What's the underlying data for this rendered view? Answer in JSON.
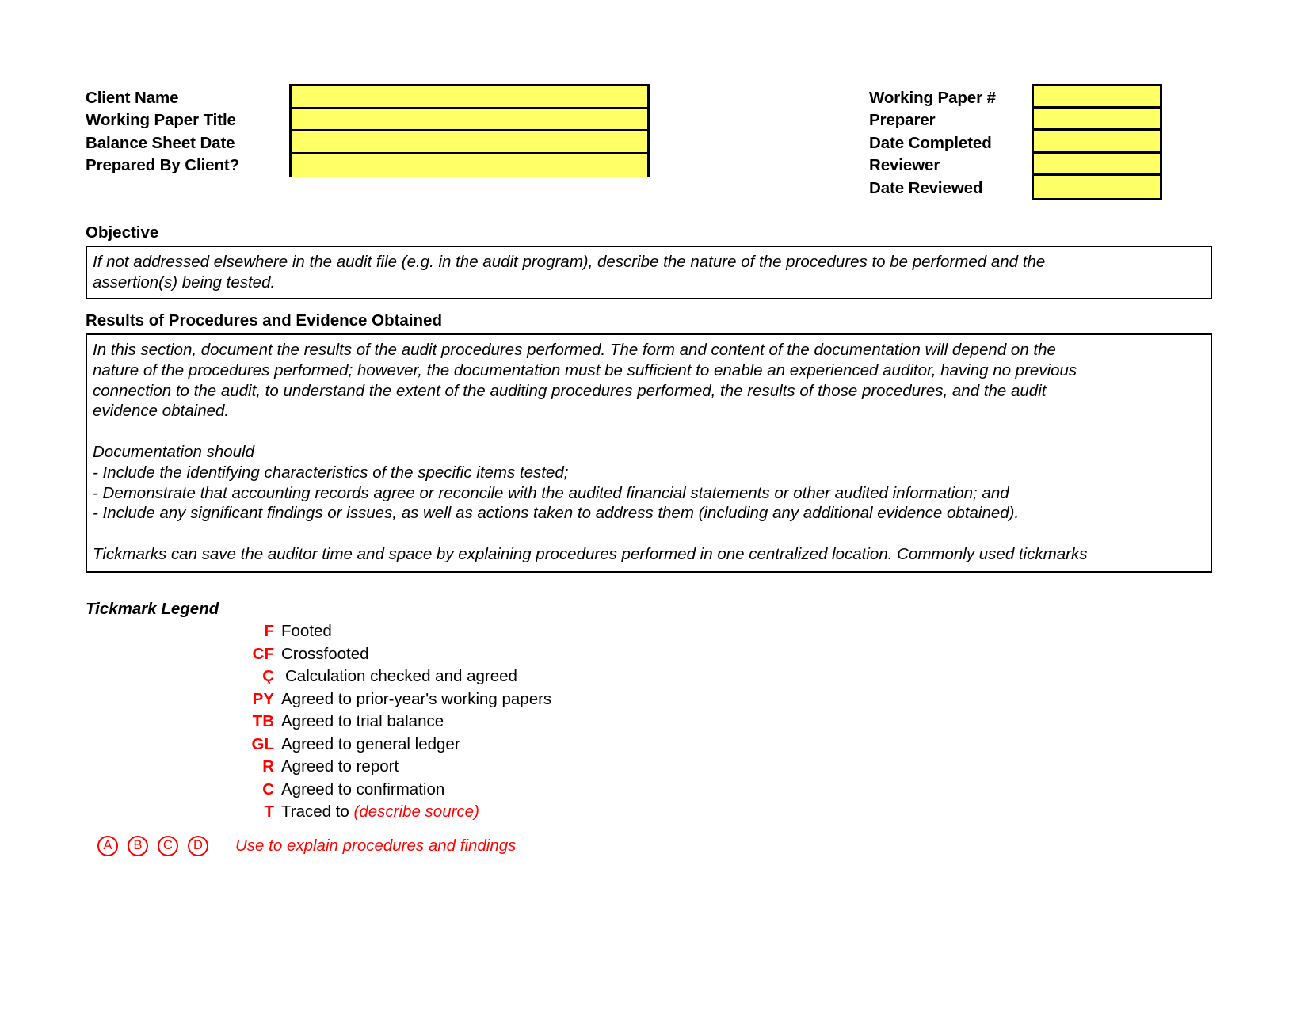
{
  "header": {
    "left_labels": [
      "Client Name",
      "Working Paper Title",
      "Balance Sheet Date",
      "Prepared By Client?"
    ],
    "left_values": [
      "",
      "",
      "",
      ""
    ],
    "right_labels": [
      "Working Paper #",
      "Preparer",
      "Date Completed",
      "Reviewer",
      "Date Reviewed"
    ],
    "right_values": [
      "",
      "",
      "",
      "",
      ""
    ],
    "field_fill_color": "#FFFF66",
    "border_color": "#000000"
  },
  "objective": {
    "heading": "Objective",
    "lines": [
      "If not addressed elsewhere in the audit file (e.g. in the audit program), describe the nature of the procedures to be performed and the",
      "assertion(s) being tested."
    ]
  },
  "results": {
    "heading": "Results of Procedures and Evidence Obtained",
    "lines": [
      "In this section, document the results of the audit procedures performed. The form and content of the documentation will depend on the",
      "nature of the procedures performed; however, the documentation must be sufficient to enable an experienced auditor, having no previous",
      "connection to the audit, to understand the extent of the auditing procedures performed, the results of those procedures, and the audit",
      "evidence obtained.",
      "",
      "Documentation should",
      "- Include the identifying characteristics of the specific items tested;",
      "- Demonstrate that accounting records agree or reconcile with the audited financial statements or other audited information; and",
      "- Include any significant findings or issues, as well as actions taken to address them (including any additional evidence obtained).",
      "",
      "Tickmarks can save the auditor time and space by explaining procedures performed in one centralized location. Commonly used tickmarks"
    ]
  },
  "tickmark_legend": {
    "heading": "Tickmark Legend",
    "symbol_color": "#FF0000",
    "rows": [
      {
        "symbol": "F",
        "desc": "Footed",
        "desc_red": ""
      },
      {
        "symbol": "CF",
        "desc": "Crossfooted",
        "desc_red": ""
      },
      {
        "symbol": "Ç",
        "desc": "Calculation checked and agreed",
        "desc_red": ""
      },
      {
        "symbol": "PY",
        "desc": "Agreed to prior-year's working papers",
        "desc_red": ""
      },
      {
        "symbol": "TB",
        "desc": "Agreed to trial balance",
        "desc_red": ""
      },
      {
        "symbol": "GL",
        "desc": "Agreed to general ledger",
        "desc_red": ""
      },
      {
        "symbol": "R",
        "desc": "Agreed to report",
        "desc_red": ""
      },
      {
        "symbol": "C",
        "desc": "Agreed to confirmation",
        "desc_red": ""
      },
      {
        "symbol": "T",
        "desc": "Traced to ",
        "desc_red": "(describe source)"
      }
    ],
    "circled_letters": [
      "A",
      "B",
      "C",
      "D"
    ],
    "circled_note": "Use to explain procedures and findings"
  }
}
